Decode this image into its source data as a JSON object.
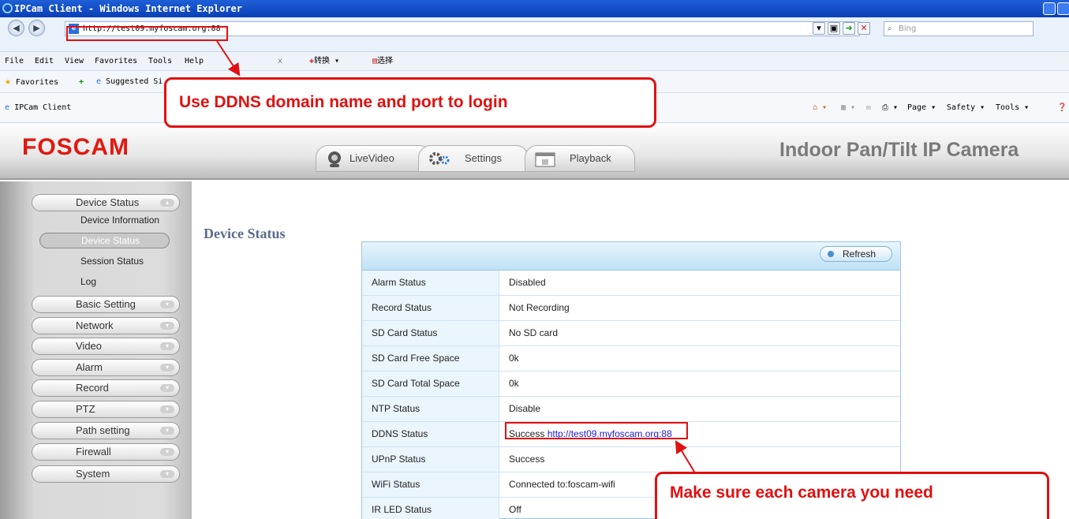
{
  "window": {
    "title": "IPCam Client - Windows Internet Explorer"
  },
  "browser": {
    "address": "http://test09.myfoscam.org:88",
    "search_placeholder": "Bing",
    "menu": [
      "File",
      "Edit",
      "View",
      "Favorites",
      "Tools",
      "Help"
    ],
    "toolbar_extra": [
      "转换",
      "选择"
    ],
    "favorites_label": "Favorites",
    "suggested_label": "Suggested Si",
    "tab_title": "IPCam Client",
    "right_tools": [
      "Page",
      "Safety",
      "Tools"
    ]
  },
  "header": {
    "logo": "FOSCAM",
    "product": "Indoor Pan/Tilt IP Camera",
    "tabs": [
      {
        "label": "LiveVideo",
        "icon": "webcam-icon"
      },
      {
        "label": "Settings",
        "icon": "gears-icon"
      },
      {
        "label": "Playback",
        "icon": "film-icon"
      }
    ]
  },
  "sidebar": {
    "groups": [
      "Device Status",
      "Basic Setting",
      "Network",
      "Video",
      "Alarm",
      "Record",
      "PTZ",
      "Path setting",
      "Firewall",
      "System"
    ],
    "sub_items": [
      "Device Information",
      "Device Status",
      "Session Status",
      "Log"
    ],
    "active_sub": "Device Status"
  },
  "content": {
    "title": "Device Status",
    "refresh_label": "Refresh",
    "rows": [
      {
        "label": "Alarm Status",
        "value": "Disabled"
      },
      {
        "label": "Record Status",
        "value": "Not Recording"
      },
      {
        "label": "SD Card Status",
        "value": "No SD card"
      },
      {
        "label": "SD Card Free Space",
        "value": "0k"
      },
      {
        "label": "SD Card Total Space",
        "value": "0k"
      },
      {
        "label": "NTP Status",
        "value": "Disable"
      },
      {
        "label": "DDNS Status",
        "value": "Success",
        "link": "http://test09.myfoscam.org:88"
      },
      {
        "label": "UPnP Status",
        "value": "Success"
      },
      {
        "label": "WiFi Status",
        "value": "Connected to:foscam-wifi"
      },
      {
        "label": "IR LED Status",
        "value": "Off"
      }
    ]
  },
  "annotations": {
    "top": "Use DDNS domain name and port to login",
    "bottom": "Make sure each camera you need"
  },
  "colors": {
    "accent": "#e01010",
    "logo": "#e0190f",
    "ie_blue": "#0a3fb5"
  }
}
